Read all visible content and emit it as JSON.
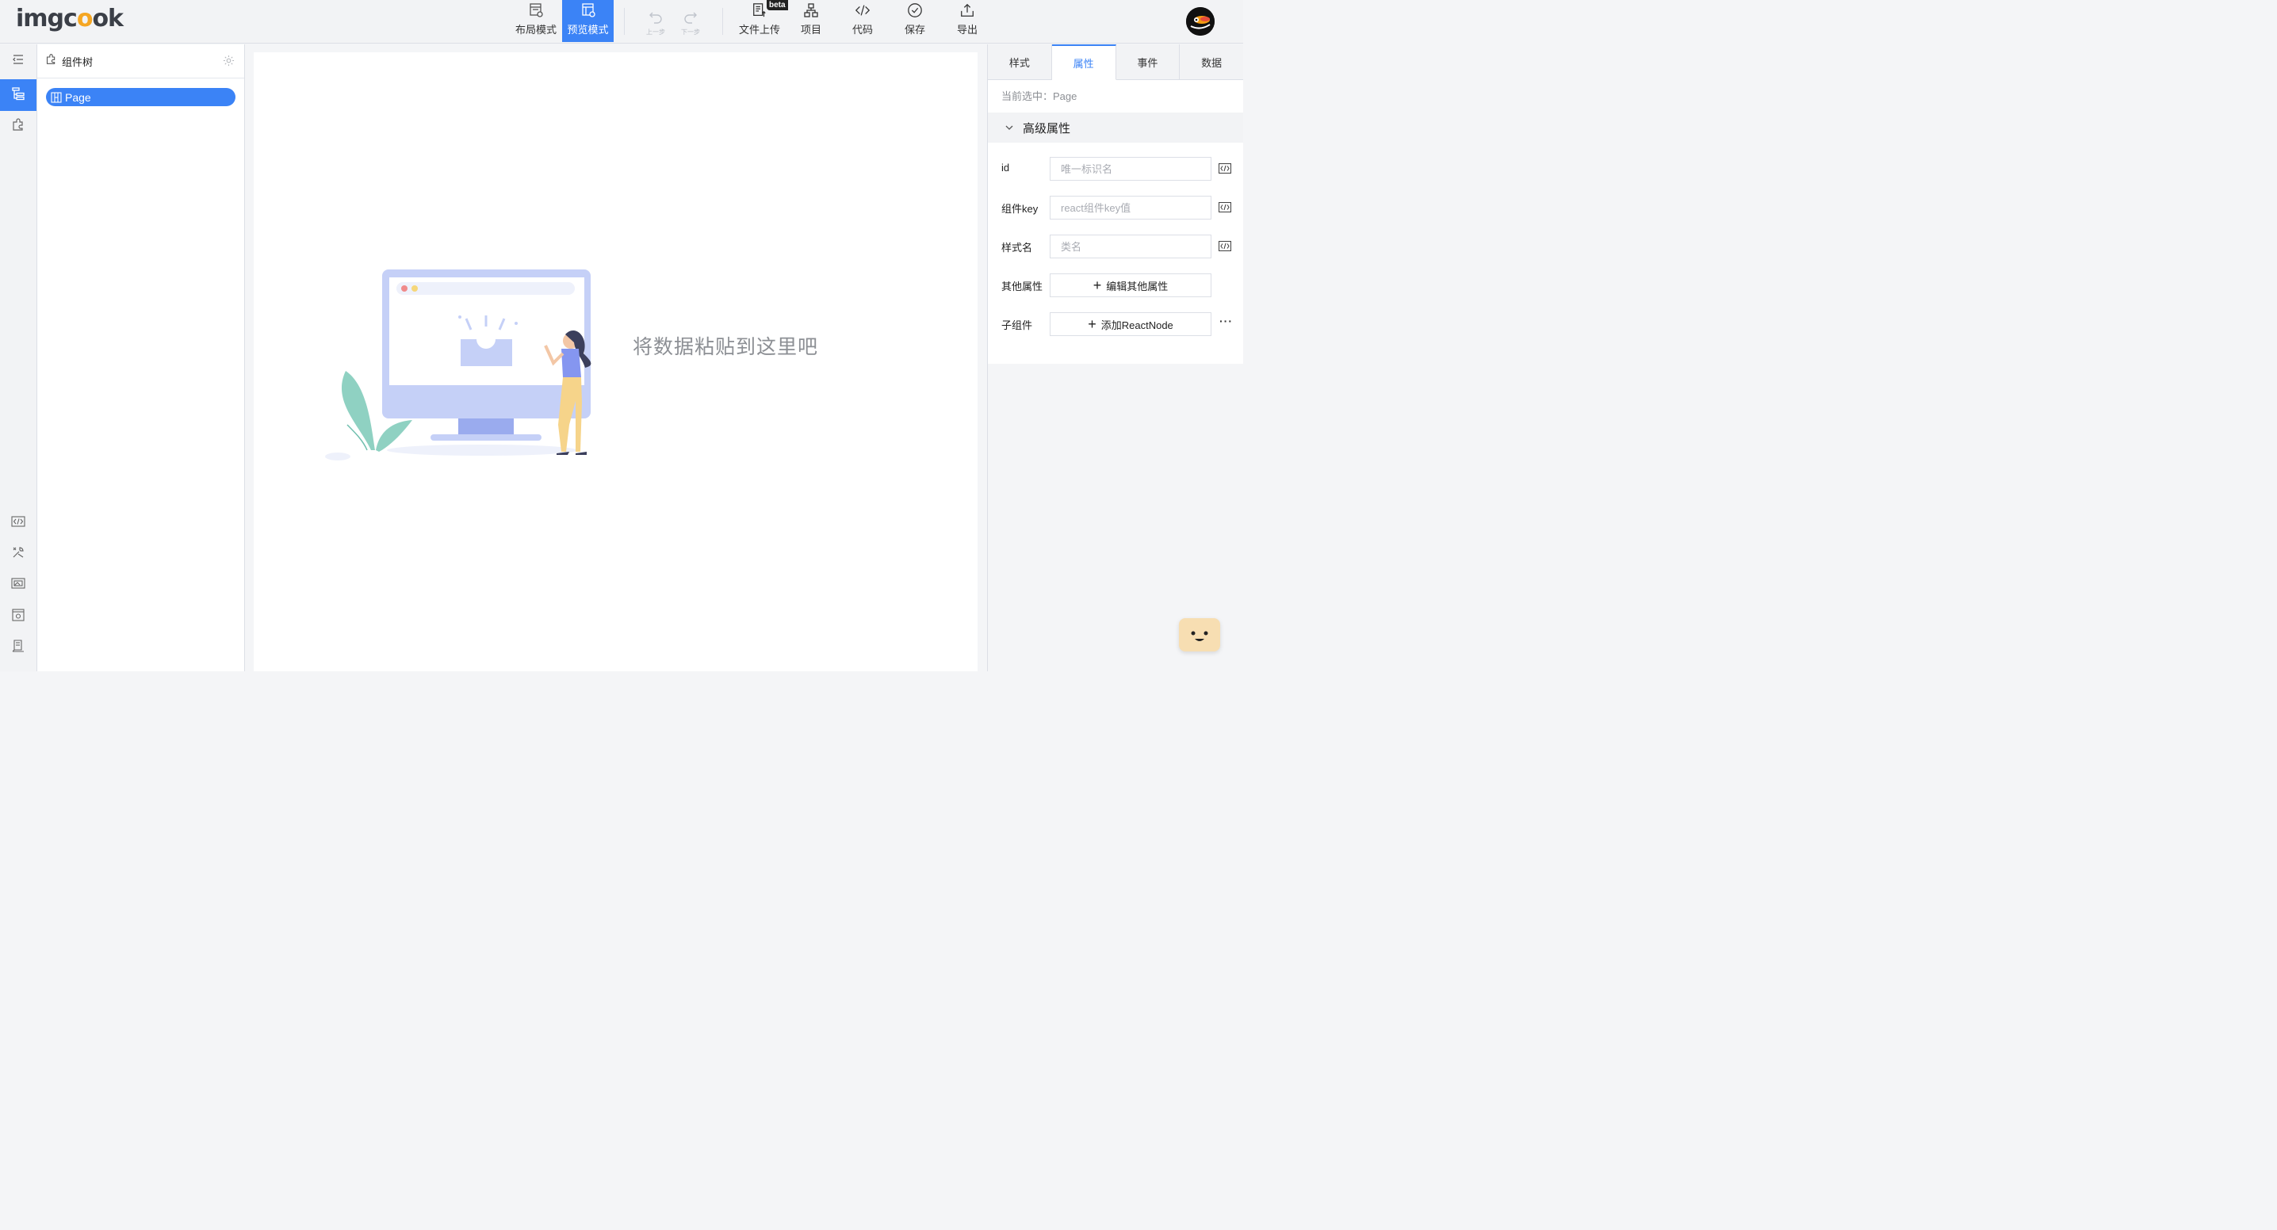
{
  "app": {
    "logo_text": "imgcook"
  },
  "toolbar": {
    "layout_mode": "布局模式",
    "preview_mode": "预览模式",
    "undo": "上一步",
    "redo": "下一步",
    "upload": "文件上传",
    "upload_badge": "beta",
    "project": "项目",
    "code": "代码",
    "save": "保存",
    "export": "导出",
    "accent": "#3b83f6"
  },
  "tree": {
    "title": "组件树",
    "root_node": "Page"
  },
  "canvas": {
    "empty_message": "将数据粘贴到这里吧"
  },
  "panel": {
    "tabs": [
      "样式",
      "属性",
      "事件",
      "数据"
    ],
    "active_tab": "属性",
    "current_selection_label": "当前选中：",
    "current_selection_value": "Page",
    "group_title": "高级属性",
    "fields": {
      "id": {
        "label": "id",
        "placeholder": "唯一标识名",
        "value": ""
      },
      "key": {
        "label": "组件key",
        "placeholder": "react组件key值",
        "value": ""
      },
      "classname": {
        "label": "样式名",
        "placeholder": "类名",
        "value": ""
      }
    },
    "other_props": {
      "label": "其他属性",
      "button": "编辑其他属性"
    },
    "children": {
      "label": "子组件",
      "button": "添加ReactNode"
    }
  },
  "icons": {
    "rail": [
      "collapse-icon",
      "component-tree-icon",
      "plugin-icon",
      "code-icon",
      "tools-icon",
      "image-icon",
      "module-icon",
      "docs-icon"
    ]
  }
}
